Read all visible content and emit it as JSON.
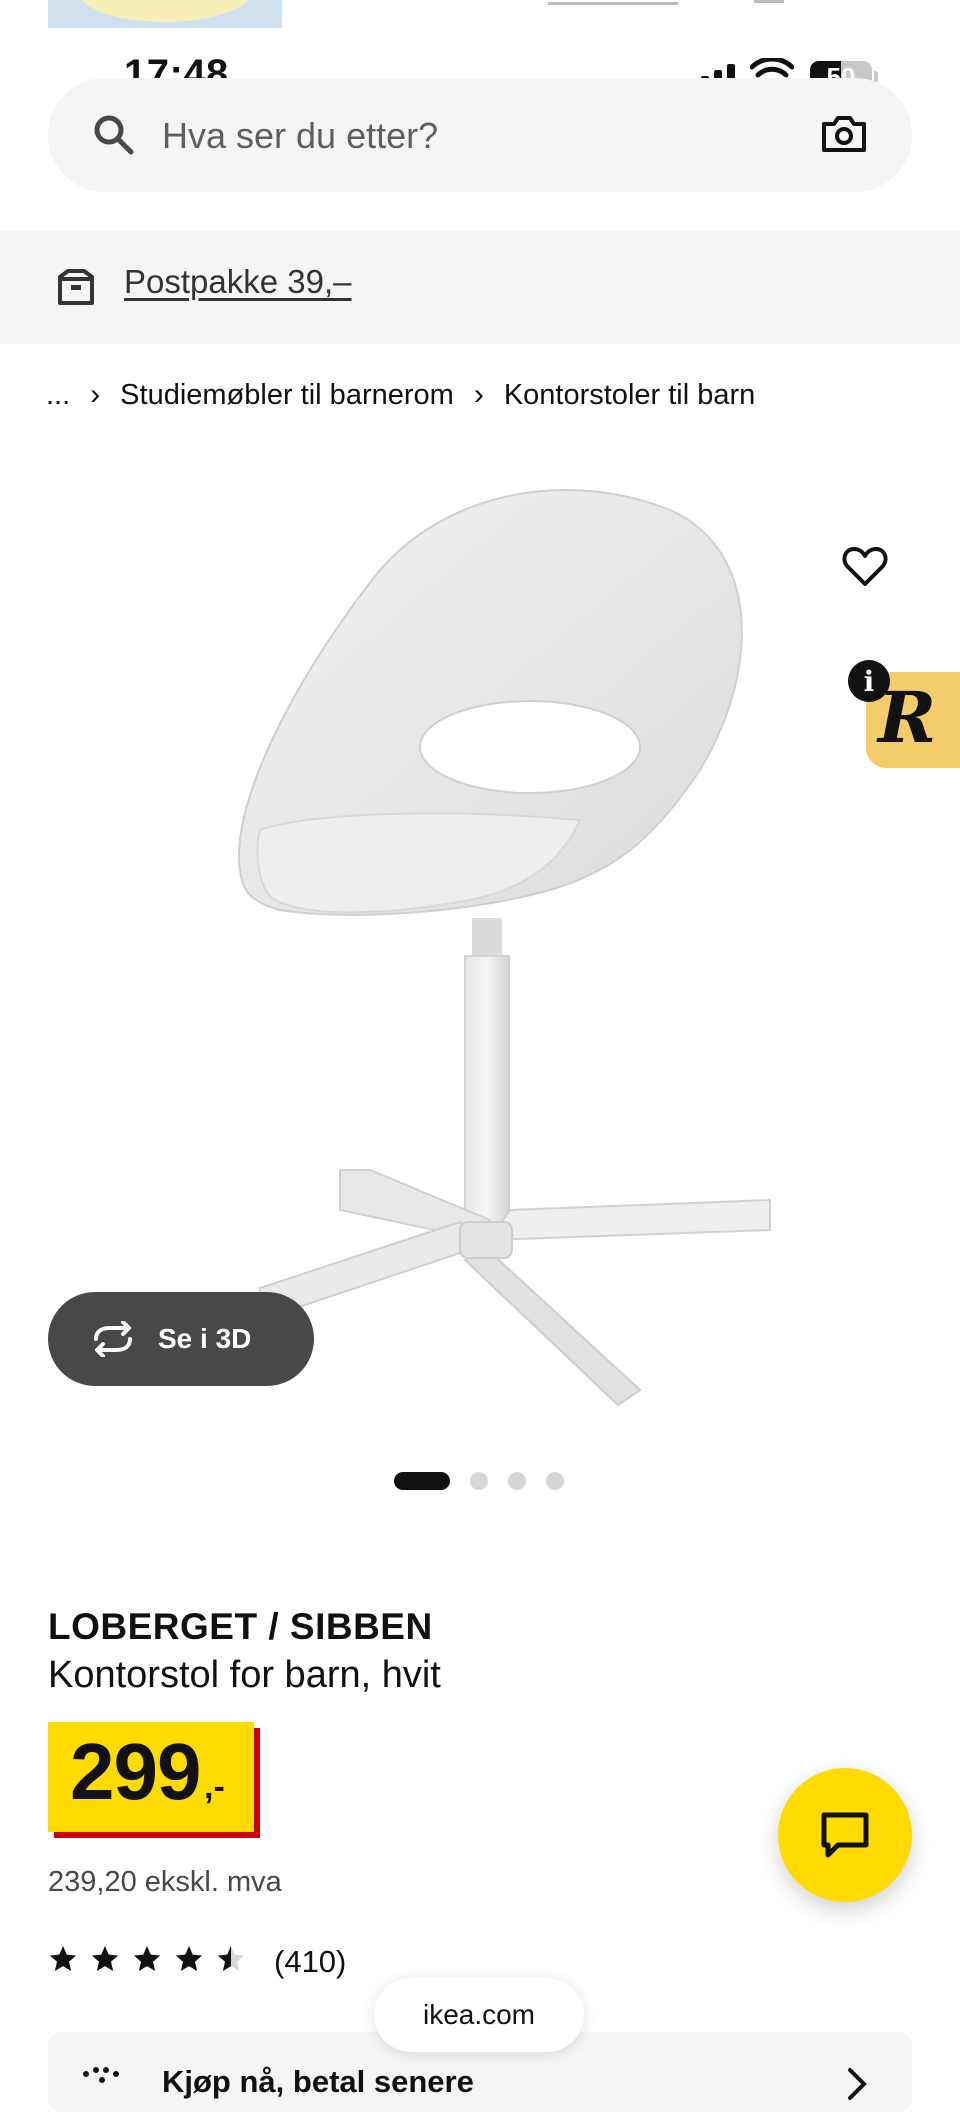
{
  "status_bar": {
    "time": "17:48",
    "battery": "50"
  },
  "search": {
    "placeholder": "Hva ser du etter?"
  },
  "delivery": {
    "text": "Postpakke 39,–"
  },
  "breadcrumb": {
    "items": [
      "...",
      "Studiemøbler til barnerom",
      "Kontorstoler til barn"
    ]
  },
  "view3d": {
    "label": "Se i 3D"
  },
  "carousel": {
    "count": 4,
    "active": 1
  },
  "product": {
    "name": "LOBERGET / SIBBEN",
    "description": "Kontorstol for barn, hvit",
    "price_main": "299",
    "price_suffix": ",-",
    "price_ex_vat": "239,20 ekskl. mva",
    "rating": 4.5,
    "review_count": "(410)"
  },
  "badge": {
    "letter": "R",
    "info": "i"
  },
  "browser": {
    "url": "ikea.com"
  },
  "payment": {
    "text": "Kjøp nå, betal senere"
  },
  "colors": {
    "ikea_yellow": "#ffdb00",
    "price_shadow": "#cc0008",
    "dark_button": "#484848",
    "badge": "#f5cc6a"
  }
}
